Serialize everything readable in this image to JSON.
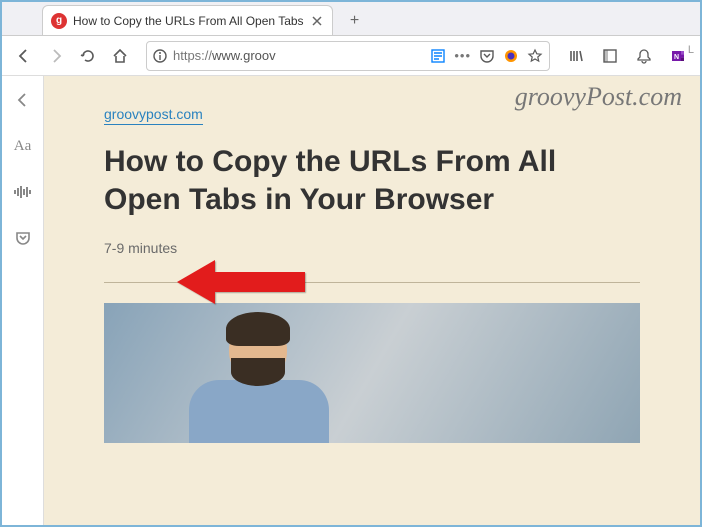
{
  "tab": {
    "title": "How to Copy the URLs From All Open Tabs",
    "favicon_letter": "g"
  },
  "urlbar": {
    "protocol": "https://",
    "host": "www.groov",
    "value": "https://www.groov"
  },
  "reader_sidebar": {
    "back": "←",
    "typography": "Aa",
    "narrate": "≡",
    "pocket": "▾"
  },
  "article": {
    "site": "groovypost.com",
    "title": "How to Copy the URLs From All Open Tabs in Your Browser",
    "read_time": "7-9 minutes"
  },
  "watermark": "groovyPost.com",
  "account_badge": "L"
}
